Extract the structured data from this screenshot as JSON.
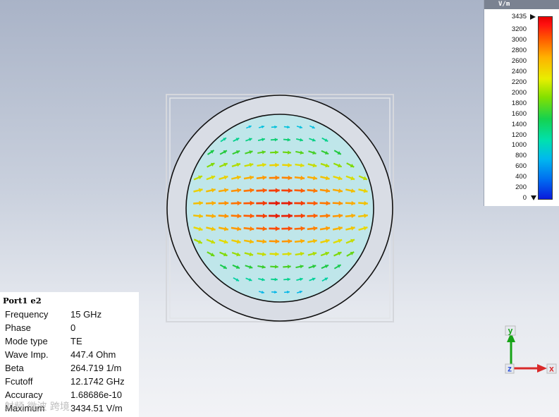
{
  "legend": {
    "unit": "V/m",
    "max_label": "3435",
    "ticks": [
      "3200",
      "3000",
      "2800",
      "2600",
      "2400",
      "2200",
      "2000",
      "1800",
      "1600",
      "1400",
      "1200",
      "1000",
      "800",
      "600",
      "400",
      "200",
      "0"
    ]
  },
  "info": {
    "title": "Port1 e2",
    "rows": [
      {
        "label": "Frequency",
        "value": "15 GHz"
      },
      {
        "label": "Phase",
        "value": "0"
      },
      {
        "label": "Mode type",
        "value": "TE"
      },
      {
        "label": "Wave Imp.",
        "value": "447.4 Ohm"
      },
      {
        "label": "Beta",
        "value": "264.719 1/m"
      },
      {
        "label": "Fcutoff",
        "value": "12.1742 GHz"
      },
      {
        "label": "Accuracy",
        "value": "1.68686e-10"
      },
      {
        "label": "Maximum",
        "value": "3434.51 V/m"
      }
    ],
    "watermark": "射频 微波 跨境"
  },
  "axes": {
    "y": "y",
    "x": "x",
    "z": "z"
  },
  "colors": {
    "accent_red": "#ff1010",
    "field_fill": "#bfe6ea"
  },
  "field": {
    "max_value": 3434.51,
    "field_type": "TE11 E-field"
  }
}
